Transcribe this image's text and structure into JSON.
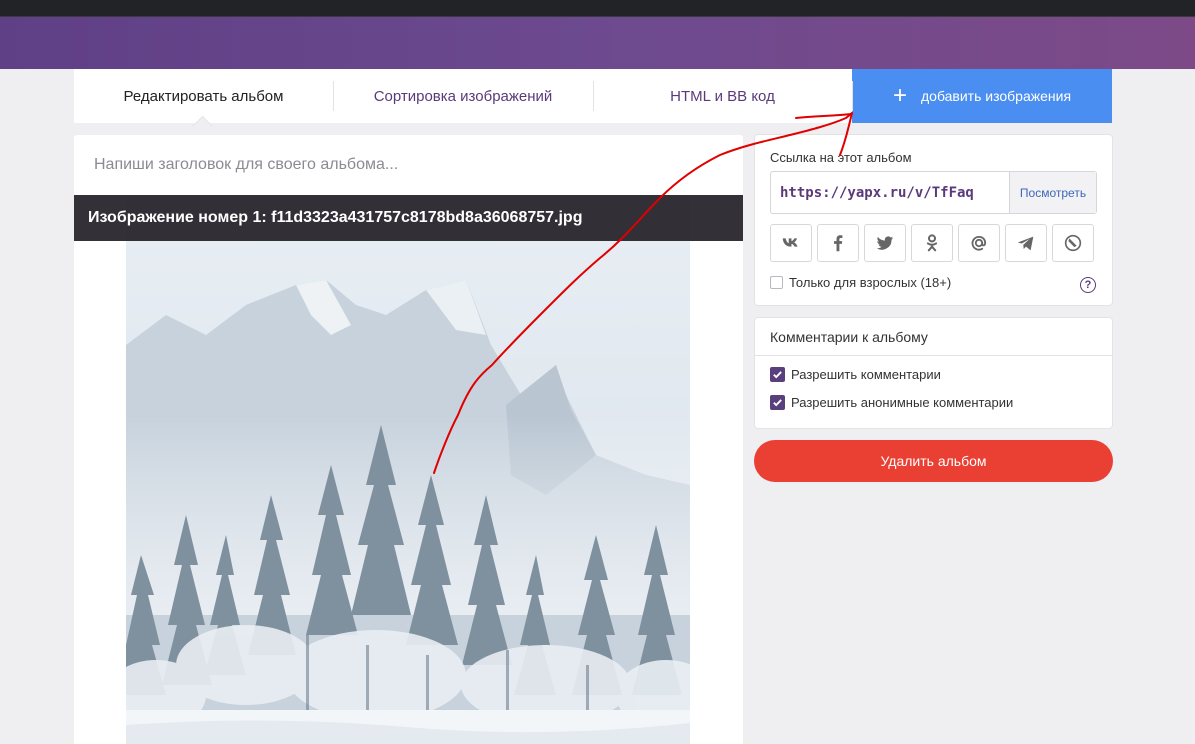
{
  "tabs": {
    "edit_album": "Редактировать альбом",
    "sort_images": "Сортировка изображений",
    "html_bb_code": "HTML и BB код",
    "add_images": "добавить изображения"
  },
  "editor": {
    "title_placeholder": "Напиши заголовок для своего альбома...",
    "image_caption": "Изображение номер 1: f11d3323a431757c8178bd8a36068757.jpg"
  },
  "share": {
    "label": "Ссылка на этот альбом",
    "url": "https://yapx.ru/v/TfFaq",
    "view_button": "Посмотреть",
    "socials": [
      "vk-icon",
      "facebook-icon",
      "twitter-icon",
      "odnoklassniki-icon",
      "email-icon",
      "telegram-icon",
      "livejournal-icon"
    ],
    "adult_label": "Только для взрослых (18+)",
    "adult_checked": false,
    "help": "?"
  },
  "comments": {
    "title": "Комментарии к альбому",
    "allow_comments": "Разрешить комментарии",
    "allow_comments_checked": true,
    "allow_anonymous": "Разрешить анонимные комментарии",
    "allow_anonymous_checked": true
  },
  "delete_button": "Удалить альбом",
  "colors": {
    "accent_blue": "#4b8ef1",
    "brand_purple": "#6d4a8f",
    "danger_red": "#ea3f33",
    "annotation_red": "#e00000"
  }
}
